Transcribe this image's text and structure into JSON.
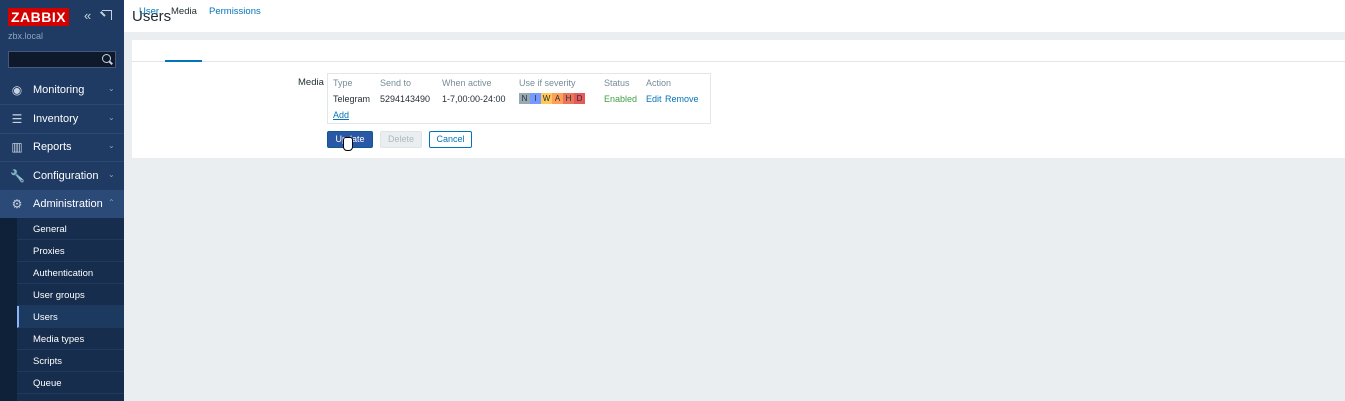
{
  "sidebar": {
    "brand": "ZABBIX",
    "server_name": "zbx.local",
    "search_placeholder": "",
    "menu": [
      {
        "label": "Monitoring",
        "icon": "eye-icon"
      },
      {
        "label": "Inventory",
        "icon": "list-icon"
      },
      {
        "label": "Reports",
        "icon": "chart-icon"
      },
      {
        "label": "Configuration",
        "icon": "wrench-icon"
      },
      {
        "label": "Administration",
        "icon": "gear-icon"
      }
    ],
    "submenu": [
      "General",
      "Proxies",
      "Authentication",
      "User groups",
      "Users",
      "Media types",
      "Scripts",
      "Queue"
    ]
  },
  "page": {
    "title": "Users",
    "tabs": [
      "User",
      "Media",
      "Permissions"
    ],
    "active_tab": "Media",
    "media_label": "Media",
    "table": {
      "headers": [
        "Type",
        "Send to",
        "When active",
        "Use if severity",
        "Status",
        "Action"
      ],
      "row": {
        "type": "Telegram",
        "send_to": "5294143490",
        "when_active": "1-7,00:00-24:00",
        "severities": [
          {
            "letter": "N",
            "color": "#97aab3"
          },
          {
            "letter": "I",
            "color": "#7499ff"
          },
          {
            "letter": "W",
            "color": "#ffc859"
          },
          {
            "letter": "A",
            "color": "#ffa059"
          },
          {
            "letter": "H",
            "color": "#e97659"
          },
          {
            "letter": "D",
            "color": "#e45959"
          }
        ],
        "status": "Enabled",
        "edit": "Edit",
        "remove": "Remove"
      },
      "add": "Add"
    },
    "buttons": {
      "update": "Update",
      "delete": "Delete",
      "cancel": "Cancel"
    }
  }
}
